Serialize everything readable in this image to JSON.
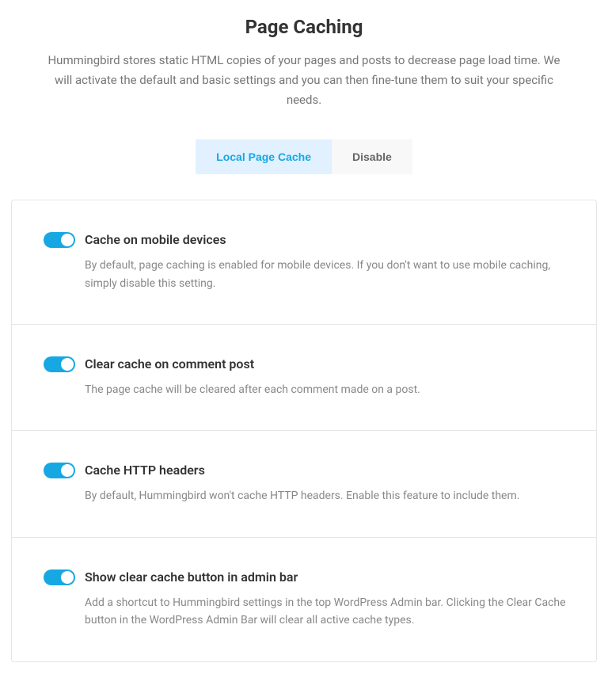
{
  "header": {
    "title": "Page Caching",
    "description": "Hummingbird stores static HTML copies of your pages and posts to decrease page load time. We will activate the default and basic settings and you can then fine-tune them to suit your specific needs."
  },
  "tabs": {
    "active": "Local Page Cache",
    "inactive": "Disable"
  },
  "settings": [
    {
      "enabled": true,
      "title": "Cache on mobile devices",
      "description": "By default, page caching is enabled for mobile devices. If you don't want to use mobile caching, simply disable this setting."
    },
    {
      "enabled": true,
      "title": "Clear cache on comment post",
      "description": "The page cache will be cleared after each comment made on a post."
    },
    {
      "enabled": true,
      "title": "Cache HTTP headers",
      "description": "By default, Hummingbird won't cache HTTP headers. Enable this feature to include them."
    },
    {
      "enabled": true,
      "title": "Show clear cache button in admin bar",
      "description": "Add a shortcut to Hummingbird settings in the top WordPress Admin bar. Clicking the Clear Cache button in the WordPress Admin Bar will clear all active cache types."
    }
  ]
}
